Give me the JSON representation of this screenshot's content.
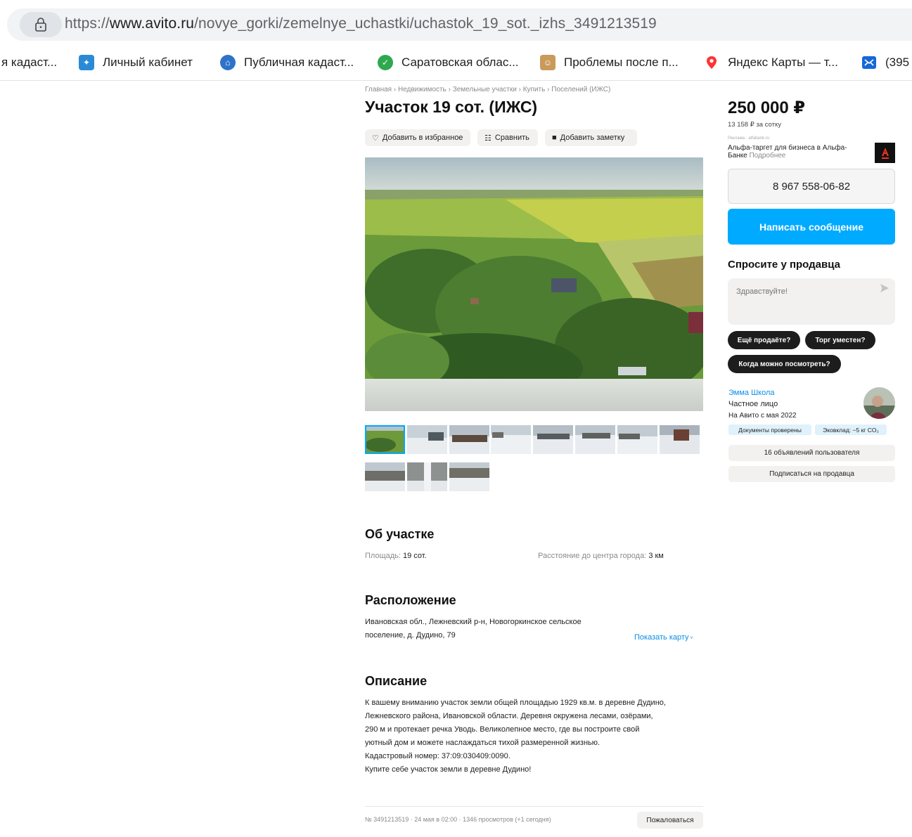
{
  "browser": {
    "url_prefix": "https://",
    "url_domain": "www.avito.ru",
    "url_path": "/novye_gorki/zemelnye_uchastki/uchastok_19_sot._izhs_3491213519",
    "bookmarks": [
      {
        "label": "я кадаст...",
        "icon": "none"
      },
      {
        "label": "Личный кабинет",
        "icon": "rosreestr-icon"
      },
      {
        "label": "Публичная кадаст...",
        "icon": "house-icon"
      },
      {
        "label": "Саратовская облас...",
        "icon": "check-circle-icon"
      },
      {
        "label": "Проблемы после п...",
        "icon": "avatar-icon"
      },
      {
        "label": "Яндекс Карты — т...",
        "icon": "map-pin-icon"
      },
      {
        "label": "(395",
        "icon": "mail-icon"
      }
    ]
  },
  "breadcrumbs": [
    "Главная",
    "Недвижимость",
    "Земельные участки",
    "Купить",
    "Поселений (ИЖС)"
  ],
  "breadcrumb_sep": "›",
  "title": "Участок 19 сот. (ИЖС)",
  "actions": {
    "favorite": "Добавить в избранное",
    "compare": "Сравнить",
    "note": "Добавить заметку"
  },
  "gallery": {
    "thumbnails_count": 11,
    "selected_index": 0
  },
  "about": {
    "heading": "Об участке",
    "area_label": "Площадь:",
    "area_value": "19 сот.",
    "distance_label": "Расстояние до центра города:",
    "distance_value": "3 км"
  },
  "location": {
    "heading": "Расположение",
    "address_line1": "Ивановская обл., Лежневский р-н, Новогоркинское сельское",
    "address_line2": "поселение, д. Дудино, 79",
    "show_map": "Показать карту"
  },
  "description": {
    "heading": "Описание",
    "lines": [
      "К вашему вниманию участок земли общей площадью 1929 кв.м. в деревне Дудино,",
      "Лежневского района, Ивановской области. Деревня окружена лесами, озёрами,",
      "290 м и протекает речка Уводь. Великолепное место, где вы построите свой",
      "уютный дом и можете наслаждаться тихой размеренной жизнью.",
      "Кадастровый номер: 37:09:030409:0090.",
      "Купите себе участок земли в деревне Дудино!"
    ]
  },
  "footer": {
    "meta": "№ 3491213519 · 24 мая в 02:00 · 1346 просмотров (+1 сегодня)",
    "report": "Пожаловаться"
  },
  "sidebar": {
    "price": "250 000 ₽",
    "per_sotka": "13 158 ₽ за сотку",
    "ad_label": "Реклама · alfabank.ru",
    "ad_text": "Альфа-таргет для бизнеса в Альфа-Банке",
    "ad_more": "Подробнее",
    "phone": "8 967 558-06-82",
    "write_message": "Написать сообщение",
    "ask_heading": "Спросите у продавца",
    "ask_placeholder": "Здравствуйте!",
    "quick_questions": [
      "Ещё продаёте?",
      "Торг уместен?",
      "Когда можно посмотреть?"
    ],
    "seller_name": "Эмма Школа",
    "seller_type": "Частное лицо",
    "seller_since": "На Авито с мая 2022",
    "badges": [
      "Документы проверены",
      "Эковклад: −5 кг CO₂"
    ],
    "listings_btn": "16 объявлений пользователя",
    "subscribe_btn": "Подписаться на продавца"
  },
  "colors": {
    "accent": "#00aaff",
    "link": "#0a8ee6",
    "dark_chip": "#1d1d1d",
    "alfa_red": "#ef3124"
  }
}
